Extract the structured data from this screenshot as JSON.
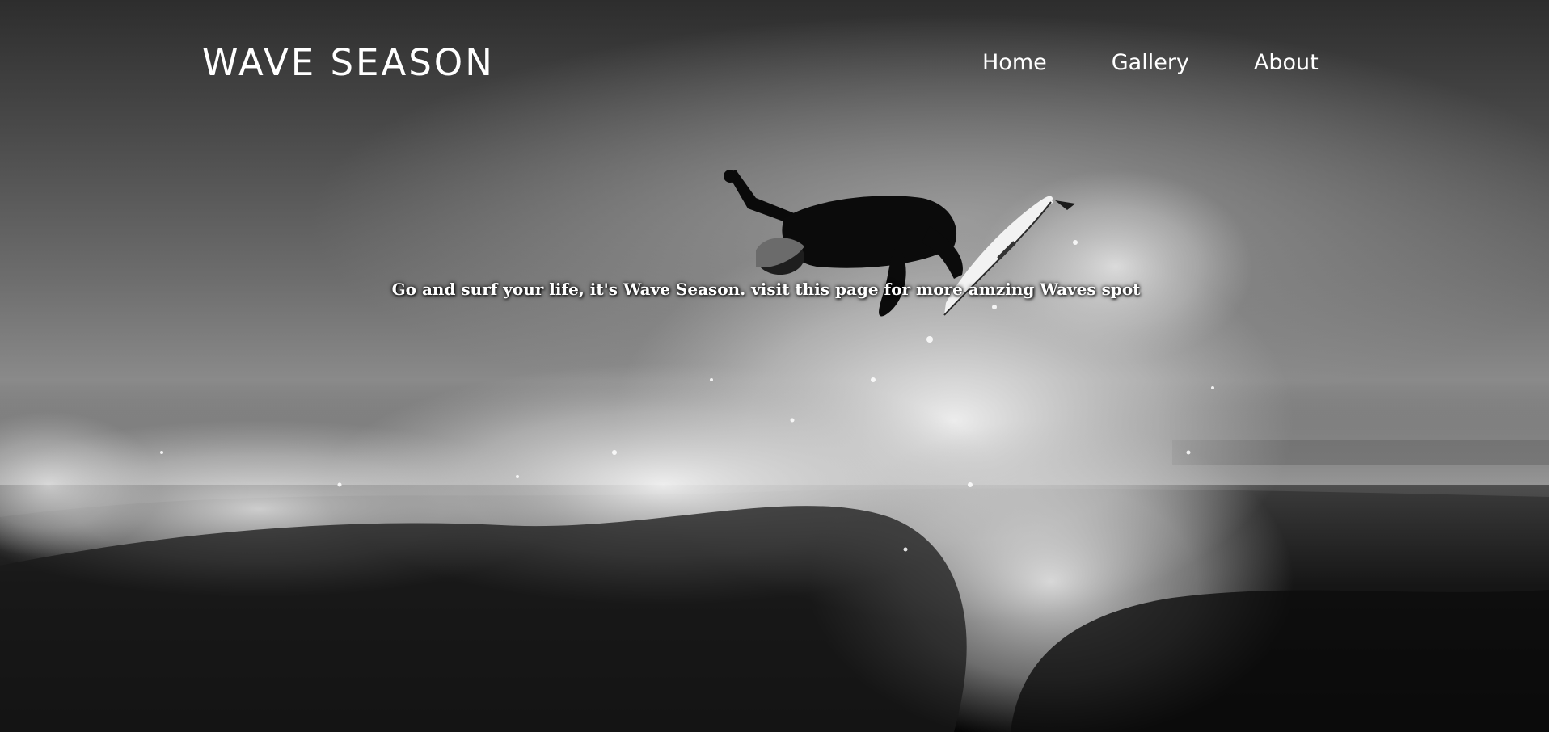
{
  "brand": {
    "title": "WAVE SEASON"
  },
  "nav": {
    "items": [
      {
        "label": "Home"
      },
      {
        "label": "Gallery"
      },
      {
        "label": "About"
      }
    ]
  },
  "hero": {
    "tagline": "Go and surf your life, it's Wave Season. visit this page for more amzing Waves spot",
    "image": "black-and-white surfer airborne above crashing wave"
  },
  "colors": {
    "text": "#ffffff",
    "background_dark": "#0e0e0e",
    "sky_mid": "#8a8a8a"
  }
}
